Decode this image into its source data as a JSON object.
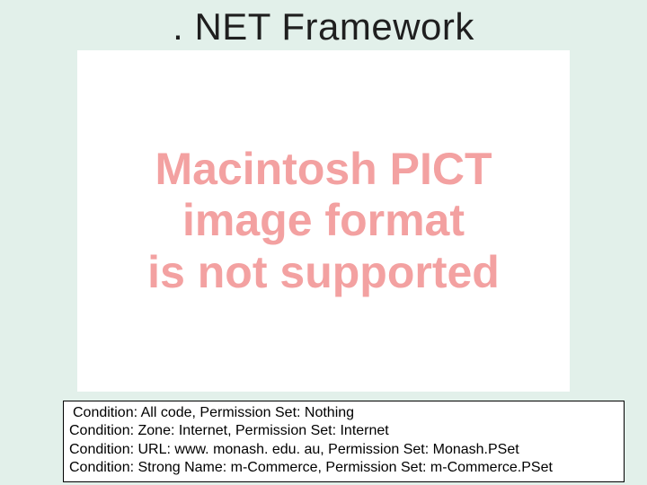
{
  "title": ". NET Framework",
  "pict_message": {
    "line1": "Macintosh PICT",
    "line2": "image format",
    "line3": "is not supported"
  },
  "conditions": {
    "line1": "Condition: All code, Permission Set: Nothing",
    "line2": "Condition: Zone: Internet, Permission Set: Internet",
    "line3": "Condition: URL: www. monash. edu. au, Permission Set: Monash.PSet",
    "line4": "Condition: Strong Name: m-Commerce, Permission Set: m-Commerce.PSet"
  }
}
